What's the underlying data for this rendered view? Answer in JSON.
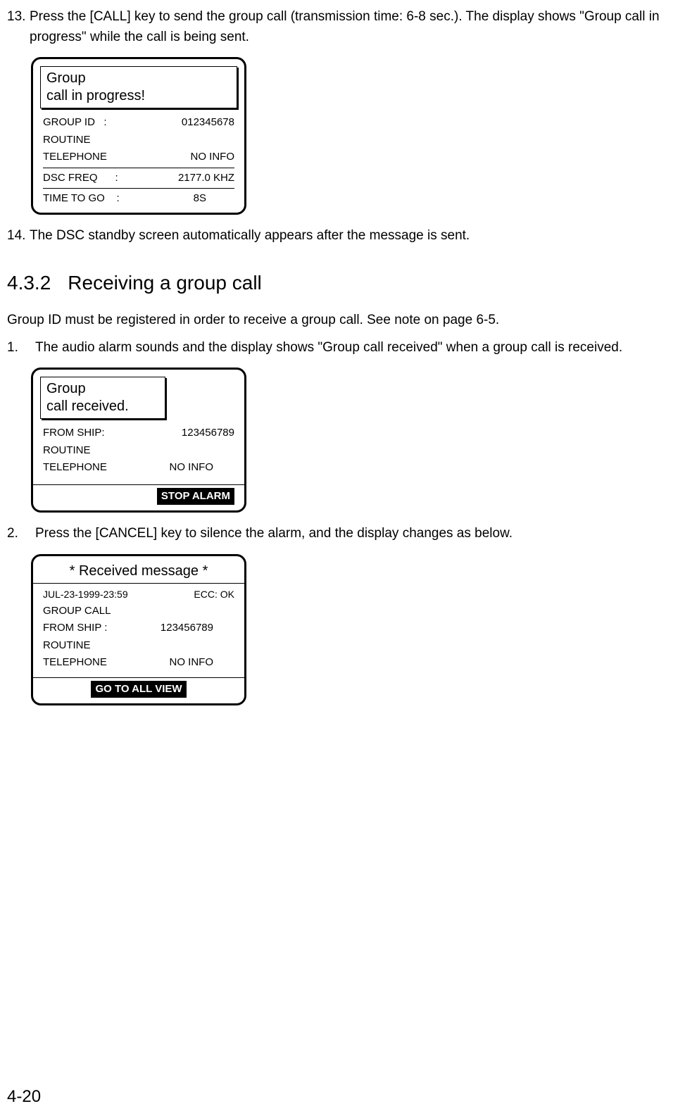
{
  "step13": {
    "num": "13.",
    "text": "Press the [CALL] key to send the group call (transmission time: 6-8 sec.). The display shows \"Group call in progress\" while the call is being sent."
  },
  "display1": {
    "headerLine1": "Group",
    "headerLine2": "call in progress!",
    "rows": [
      {
        "left": "GROUP ID   :",
        "right": "012345678"
      },
      {
        "left": "ROUTINE",
        "right": ""
      },
      {
        "left": "TELEPHONE",
        "right": "NO INFO"
      }
    ],
    "freq": {
      "left": "DSC FREQ      :",
      "right": "2177.0 KHZ"
    },
    "time": {
      "left": "TIME TO GO    :",
      "right": "8S"
    }
  },
  "step14": {
    "num": "14.",
    "text": "The DSC standby screen automatically appears after the message is sent."
  },
  "section": {
    "num": "4.3.2",
    "title": "Receiving a group call"
  },
  "intro": "Group ID must be registered in order to receive a group call. See note on page 6-5.",
  "step1": {
    "num": "1.",
    "text": "The audio alarm sounds and the display shows \"Group call received\" when a group call is received."
  },
  "display2": {
    "headerLine1": "Group",
    "headerLine2": "call received.",
    "rows": [
      {
        "left": "FROM SHIP:",
        "right": "123456789"
      },
      {
        "left": "ROUTINE",
        "right": ""
      },
      {
        "left": "TELEPHONE",
        "right": "NO INFO"
      }
    ],
    "footer": "STOP ALARM"
  },
  "step2": {
    "num": "2.",
    "text": "Press the [CANCEL] key to silence the alarm, and the display changes as below."
  },
  "display3": {
    "header": "* Received message *",
    "rows": [
      {
        "left": "JUL-23-1999-23:59",
        "right": "ECC: OK"
      },
      {
        "left": "GROUP CALL",
        "right": ""
      },
      {
        "left": "FROM SHIP :",
        "right": "123456789"
      },
      {
        "left": "ROUTINE",
        "right": ""
      },
      {
        "left": "TELEPHONE",
        "right": "NO INFO"
      }
    ],
    "footer": "GO TO ALL VIEW"
  },
  "pageNum": "4-20"
}
